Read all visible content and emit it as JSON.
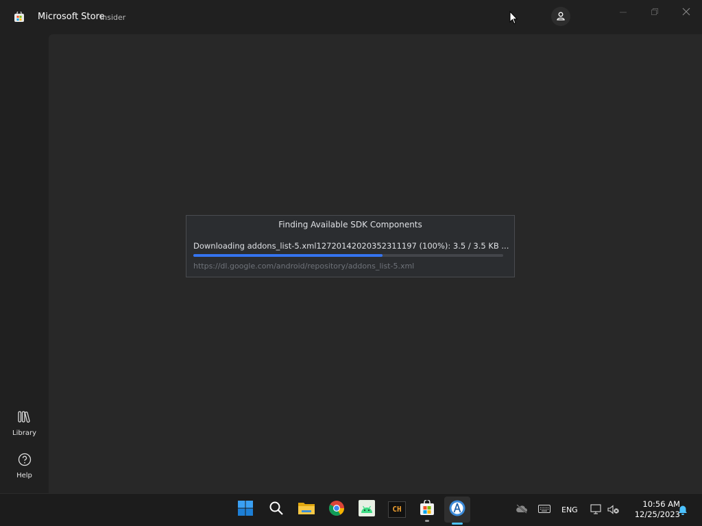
{
  "window": {
    "title": "Microsoft Store",
    "badge": "Insider"
  },
  "sidebar": {
    "items": [
      {
        "label": "Library",
        "icon": "library-icon"
      },
      {
        "label": "Help",
        "icon": "help-icon"
      }
    ]
  },
  "dialog": {
    "title": "Finding Available SDK Components",
    "status": "Downloading addons_list-5.xml12720142020352311197 (100%): 3.5 / 3.5 KB ...",
    "url": "https://dl.google.com/android/repository/addons_list-5.xml",
    "progress": 0.61,
    "accent_color": "#3574f0"
  },
  "taskbar": {
    "apps": [
      {
        "name": "Start",
        "icon": "windows-start-icon"
      },
      {
        "name": "Search",
        "icon": "search-icon"
      },
      {
        "name": "File Explorer",
        "icon": "folder-icon"
      },
      {
        "name": "Chrome",
        "icon": "chrome-icon"
      },
      {
        "name": "Android",
        "icon": "android-icon"
      },
      {
        "name": "CH",
        "icon": "ch-app-icon"
      },
      {
        "name": "Microsoft Store",
        "icon": "store-icon"
      },
      {
        "name": "Android Studio",
        "icon": "android-studio-icon"
      }
    ],
    "ch_label": "CH",
    "language": "ENG",
    "time": "10:56 AM",
    "date": "12/25/2023"
  }
}
